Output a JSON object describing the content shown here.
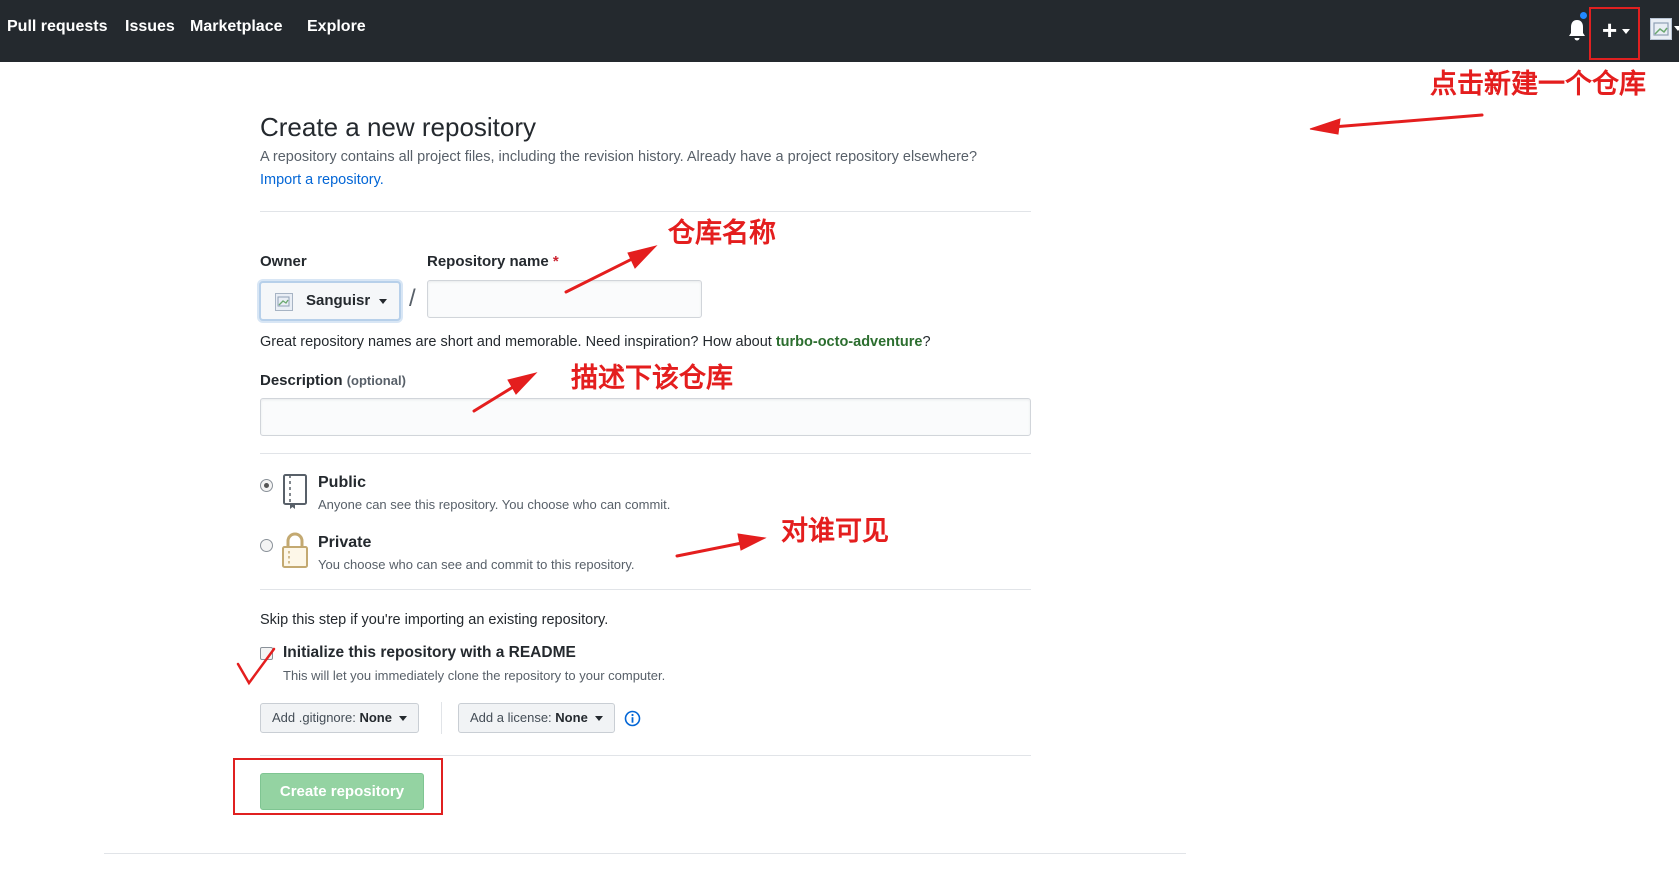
{
  "nav": {
    "links": [
      "Pull requests",
      "Issues",
      "Marketplace",
      "Explore"
    ],
    "icons": [
      "bell-icon",
      "plus-icon",
      "avatar"
    ]
  },
  "annotations": {
    "new_repo": "点击新建一个仓库",
    "repo_name": "仓库名称",
    "description": "描述下该仓库",
    "visibility": "对谁可见"
  },
  "page": {
    "title": "Create a new repository",
    "subtitle": "A repository contains all project files, including the revision history. Already have a project repository elsewhere?",
    "import_link": "Import a repository."
  },
  "form": {
    "owner_label": "Owner",
    "owner_value": "Sanguisr",
    "repo_name_label": "Repository name",
    "required_mark": "*",
    "slash": "/",
    "repo_name_value": "",
    "hint_prefix": "Great repository names are short and memorable. Need inspiration? How about ",
    "hint_suggestion": "turbo-octo-adventure",
    "hint_suffix": "?",
    "description_label": "Description",
    "description_optional": "(optional)",
    "description_value": ""
  },
  "visibility": {
    "selected": "public",
    "public_title": "Public",
    "public_desc": "Anyone can see this repository. You choose who can commit.",
    "private_title": "Private",
    "private_desc": "You choose who can see and commit to this repository."
  },
  "init": {
    "skip_text": "Skip this step if you're importing an existing repository.",
    "readme_label": "Initialize this repository with a README",
    "readme_desc": "This will let you immediately clone the repository to your computer.",
    "readme_checked": false,
    "gitignore_prefix": "Add .gitignore:",
    "gitignore_value": "None",
    "license_prefix": "Add a license:",
    "license_value": "None"
  },
  "actions": {
    "create_label": "Create repository"
  },
  "colors": {
    "nav_bg": "#24292e",
    "link": "#0366d6",
    "annotation_red": "#e41e1e",
    "create_button": "#94d3a2"
  }
}
